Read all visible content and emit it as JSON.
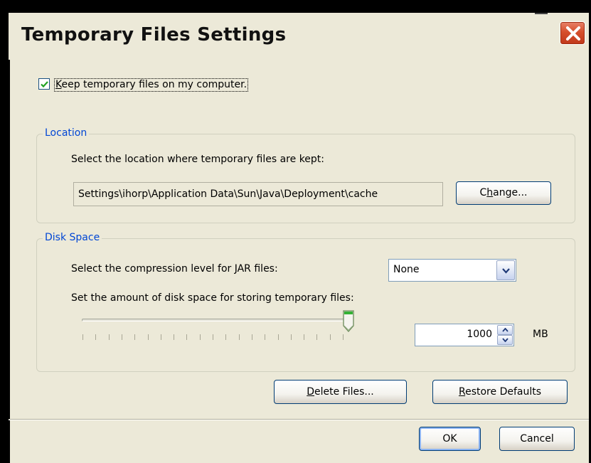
{
  "window": {
    "title": "Temporary Files Settings",
    "close_icon": "close-icon",
    "accent_color": "#d64f2c"
  },
  "keep_files": {
    "checked": true,
    "label_pre": "",
    "label_mnemonic": "K",
    "label_post": "eep temporary files on my computer."
  },
  "location": {
    "legend": "Location",
    "prompt": "Select the location where temporary files are kept:",
    "path": "Settings\\ihorp\\Application Data\\Sun\\Java\\Deployment\\cache",
    "change_pre": "C",
    "change_mnemonic": "h",
    "change_post": "ange..."
  },
  "disk_space": {
    "legend": "Disk Space",
    "compression_prompt": "Select the compression level for JAR files:",
    "compression_value": "None",
    "amount_prompt": "Set the amount of disk space for storing temporary files:",
    "slider_level": 1.0,
    "amount_value": "1000",
    "unit": "MB"
  },
  "actions": {
    "delete_mnemonic": "D",
    "delete_post": "elete Files...",
    "restore_mnemonic": "R",
    "restore_post": "estore Defaults",
    "ok_label": "OK",
    "cancel_label": "Cancel"
  },
  "colors": {
    "dialog_bg": "#ece9d8",
    "group_legend": "#0046d5",
    "button_border": "#003c74",
    "checkmark": "#21a121"
  }
}
